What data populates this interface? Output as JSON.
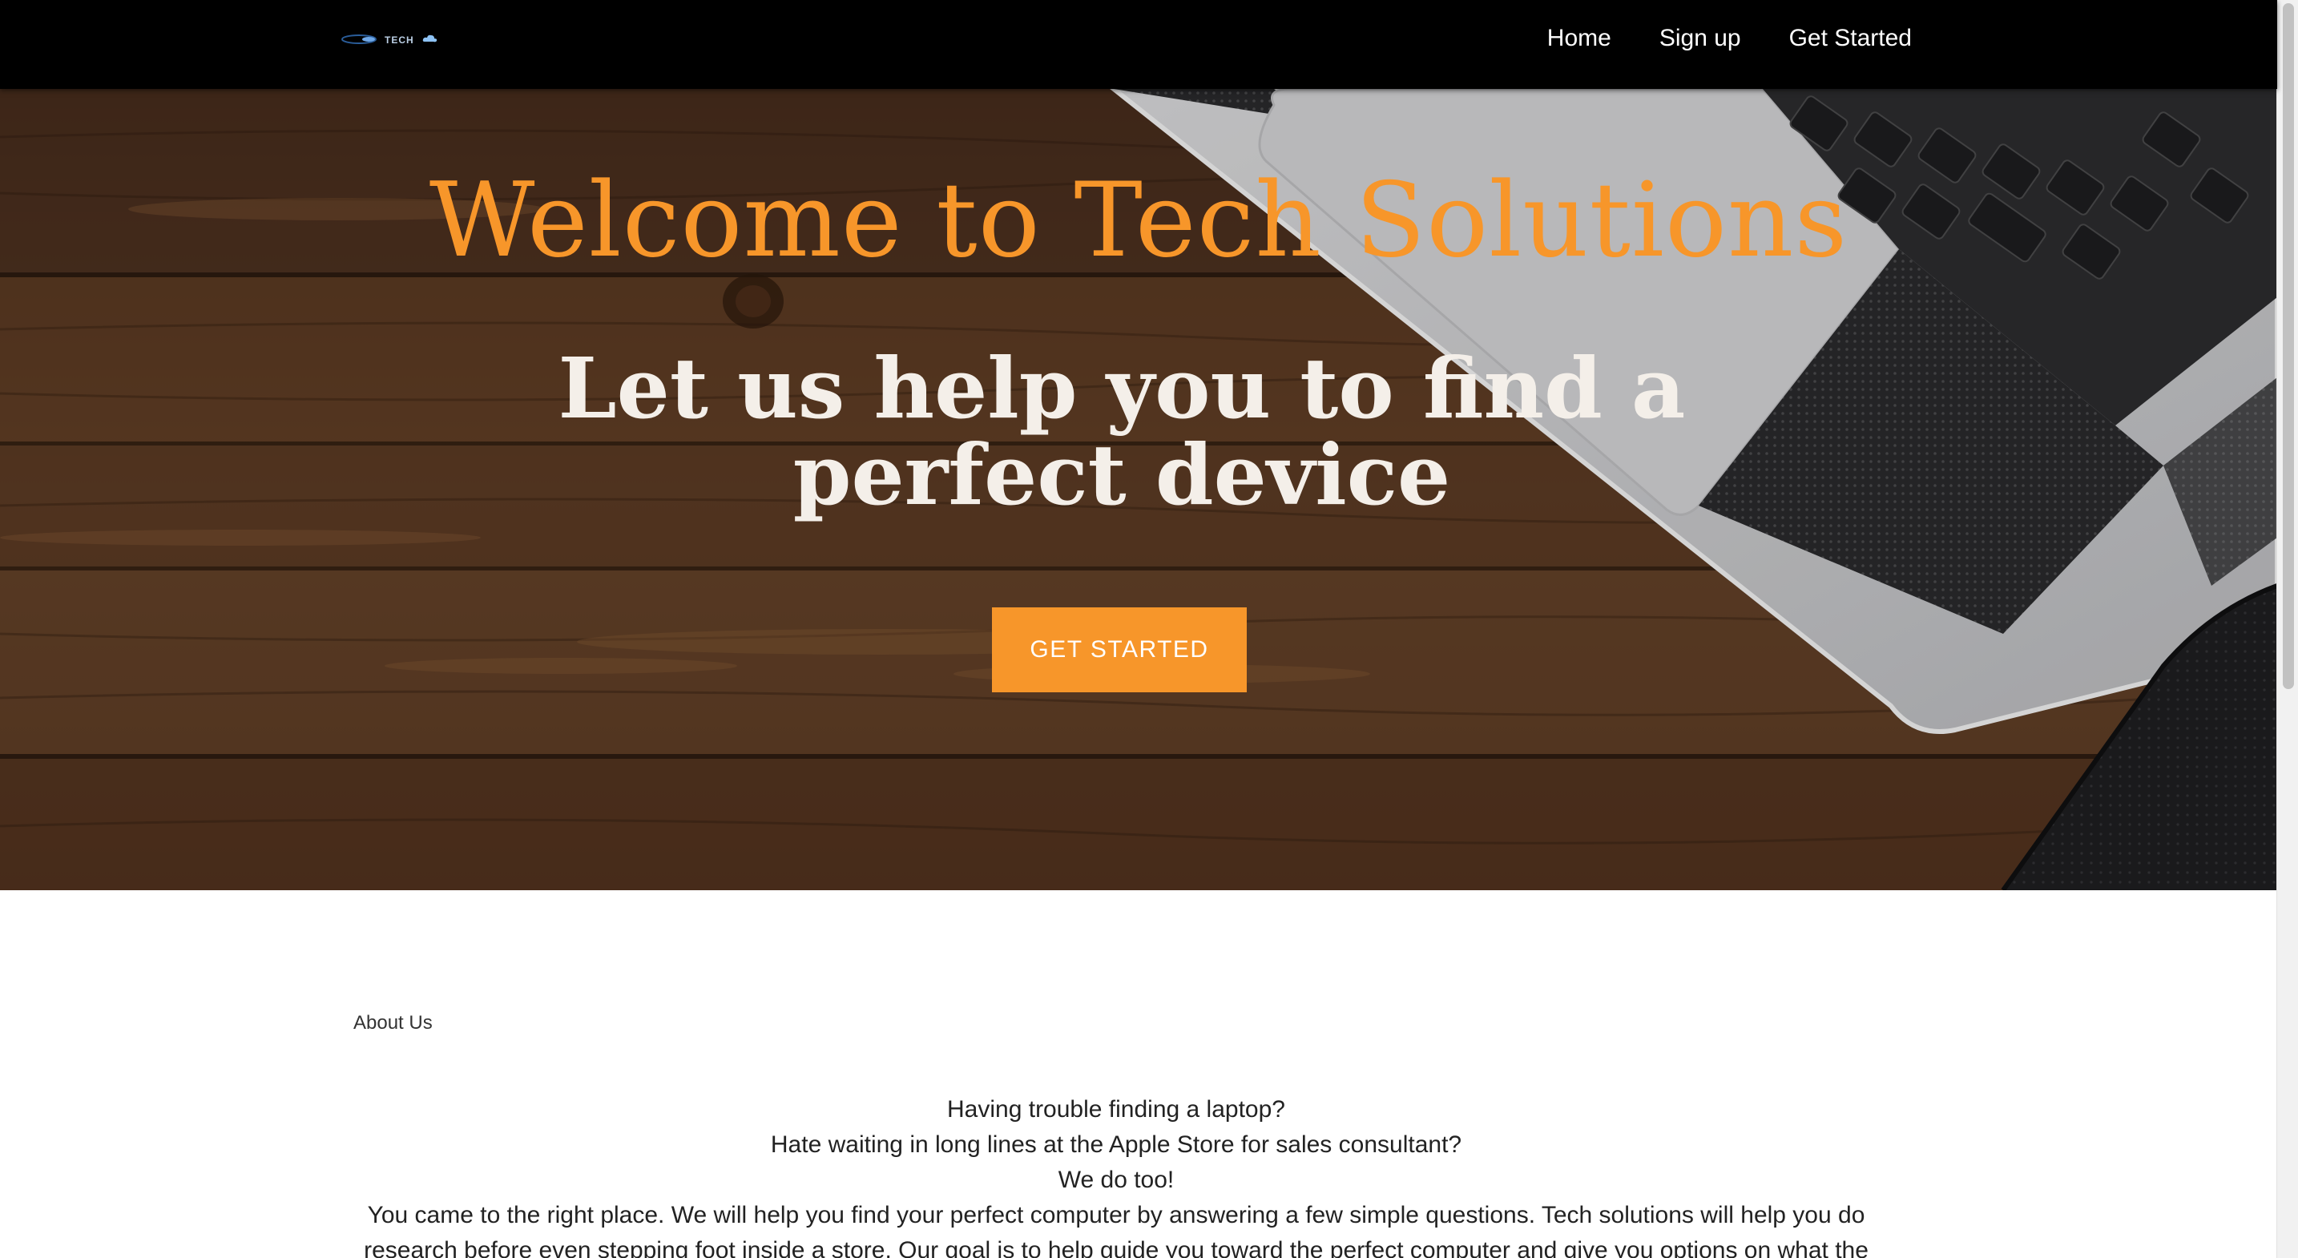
{
  "navbar": {
    "logo_text": "TECH",
    "links": {
      "home": "Home",
      "signup": "Sign up",
      "get_started": "Get Started"
    }
  },
  "hero": {
    "title": "Welcome to Tech Solutions",
    "subtitle": "Let us help you to find a perfect device",
    "button_label": "GET STARTED"
  },
  "about": {
    "heading": "About Us",
    "lines": [
      "Having trouble finding a laptop?",
      "Hate waiting in long lines at the Apple Store for sales consultant?",
      "We do too!",
      "You came to the right place. We will help you find your perfect computer by answering a few simple questions. Tech solutions will help you do research before even stepping foot inside a store. Our goal is to help guide you toward the perfect computer and give you options on what the"
    ]
  },
  "colors": {
    "accent": "#f7962a",
    "navbar": "#000000",
    "hero_subtitle": "#f4efe9"
  },
  "icons": {
    "logo": "tech-logo",
    "scrollbar": "vertical-scrollbar"
  }
}
